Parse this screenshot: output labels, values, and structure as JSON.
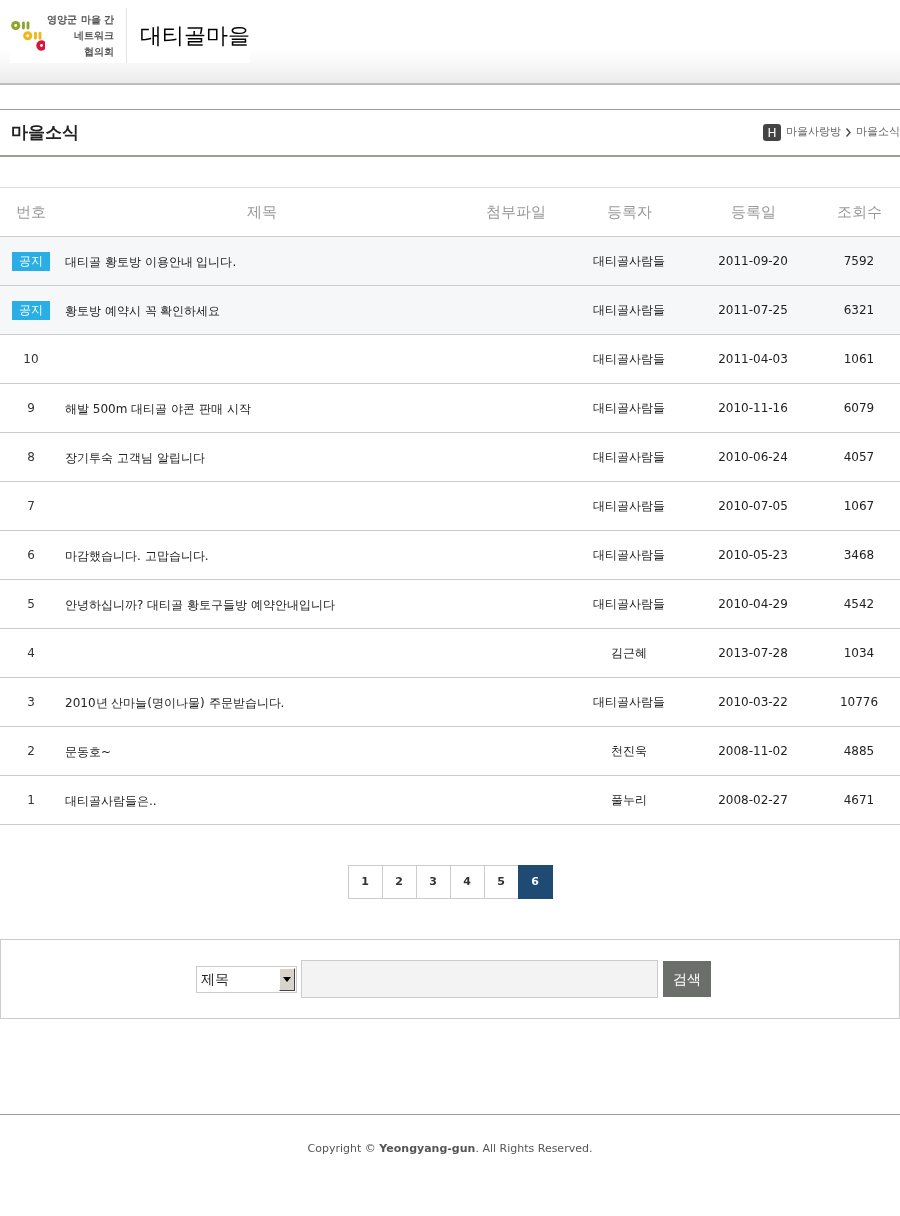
{
  "header": {
    "logo_lines": [
      "영양군 마을 간",
      "네트워크",
      "협의회"
    ],
    "site_title": "대티골마을"
  },
  "section": {
    "title": "마을소식",
    "breadcrumb_home": "H",
    "breadcrumb": [
      "마을사랑방",
      "마을소식"
    ]
  },
  "table": {
    "columns": [
      "번호",
      "제목",
      "첨부파일",
      "등록자",
      "등록일",
      "조회수"
    ],
    "rows": [
      {
        "kind": "notice",
        "number": "공지",
        "title": "대티골 황토방 이용안내 입니다.",
        "author": "대티골사람들",
        "date": "2011-09-20",
        "views": "7592"
      },
      {
        "kind": "notice",
        "number": "공지",
        "title": "황토방 예약시 꼭 확인하세요",
        "author": "대티골사람들",
        "date": "2011-07-25",
        "views": "6321"
      },
      {
        "kind": "post",
        "number": "10",
        "author": "대티골사람들",
        "date": "2011-04-03",
        "views": "1061"
      },
      {
        "kind": "post",
        "number": "9",
        "title": "해발 500m 대티골 야콘 판매 시작",
        "author": "대티골사람들",
        "date": "2010-11-16",
        "views": "6079"
      },
      {
        "kind": "post",
        "number": "8",
        "title": "장기투숙 고객님 알립니다",
        "author": "대티골사람들",
        "date": "2010-06-24",
        "views": "4057"
      },
      {
        "kind": "post",
        "number": "7",
        "author": "대티골사람들",
        "date": "2010-07-05",
        "views": "1067"
      },
      {
        "kind": "post",
        "number": "6",
        "title": "마감했습니다. 고맙습니다.",
        "author": "대티골사람들",
        "date": "2010-05-23",
        "views": "3468"
      },
      {
        "kind": "post",
        "number": "5",
        "title": "안녕하십니까? 대티골 황토구들방 예약안내입니다",
        "author": "대티골사람들",
        "date": "2010-04-29",
        "views": "4542"
      },
      {
        "kind": "post",
        "number": "4",
        "author": "김근혜",
        "date": "2013-07-28",
        "views": "1034"
      },
      {
        "kind": "post",
        "number": "3",
        "title": "2010년 산마늘(명이나물) 주문받습니다.",
        "author": "대티골사람들",
        "date": "2010-03-22",
        "views": "10776"
      },
      {
        "kind": "post",
        "number": "2",
        "title": "문동호~",
        "author": "천진욱",
        "date": "2008-11-02",
        "views": "4885"
      },
      {
        "kind": "post",
        "number": "1",
        "title": "대티골사람들은..",
        "author": "풀누리",
        "date": "2008-02-27",
        "views": "4671"
      }
    ]
  },
  "pagination": [
    {
      "label": "1",
      "selected": false
    },
    {
      "label": "2",
      "selected": false
    },
    {
      "label": "3",
      "selected": false
    },
    {
      "label": "4",
      "selected": false
    },
    {
      "label": "5",
      "selected": false
    },
    {
      "label": "6",
      "selected": true
    }
  ],
  "search": {
    "field_select": "제목",
    "button": "검색"
  },
  "footer": {
    "copyright": "Copyright © **Yeongyang-gun**. All Rights Reserved."
  }
}
